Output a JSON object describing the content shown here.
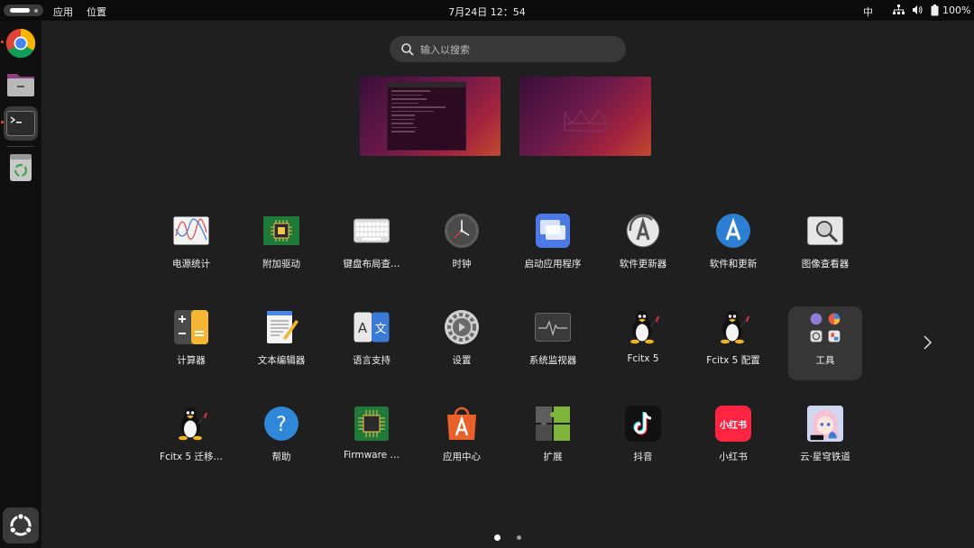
{
  "topbar": {
    "menu_apps": "应用",
    "menu_places": "位置",
    "clock": "7月24日  12：54",
    "ime": "中",
    "battery": "100%"
  },
  "dock": {
    "items": [
      {
        "name": "chrome",
        "icon": "chrome-icon"
      },
      {
        "name": "files",
        "icon": "folder-icon"
      },
      {
        "name": "terminal",
        "icon": "terminal-icon"
      },
      {
        "name": "trash",
        "icon": "trash-icon"
      },
      {
        "name": "show-apps",
        "icon": "ubuntu-icon"
      }
    ]
  },
  "search": {
    "placeholder": "输入以搜索"
  },
  "apps": [
    {
      "label": "电源统计",
      "icon": "power-statistics-icon"
    },
    {
      "label": "附加驱动",
      "icon": "chip-icon"
    },
    {
      "label": "键盘布局查…",
      "icon": "keyboard-icon"
    },
    {
      "label": "时钟",
      "icon": "clock-icon"
    },
    {
      "label": "启动应用程序",
      "icon": "startup-apps-icon"
    },
    {
      "label": "软件更新器",
      "icon": "software-updater-icon"
    },
    {
      "label": "软件和更新",
      "icon": "software-update-icon"
    },
    {
      "label": "图像查看器",
      "icon": "image-viewer-icon"
    },
    {
      "label": "计算器",
      "icon": "calculator-icon"
    },
    {
      "label": "文本编辑器",
      "icon": "text-editor-icon"
    },
    {
      "label": "语言支持",
      "icon": "language-icon"
    },
    {
      "label": "设置",
      "icon": "settings-icon"
    },
    {
      "label": "系统监视器",
      "icon": "system-monitor-icon"
    },
    {
      "label": "Fcitx 5",
      "icon": "tux-icon"
    },
    {
      "label": "Fcitx 5 配置",
      "icon": "tux-icon"
    },
    {
      "label": "工具",
      "icon": "folder-tools-icon"
    },
    {
      "label": "Fcitx 5 迁移…",
      "icon": "tux-icon"
    },
    {
      "label": "帮助",
      "icon": "help-icon"
    },
    {
      "label": "Firmware …",
      "icon": "firmware-icon"
    },
    {
      "label": "应用中心",
      "icon": "app-center-icon"
    },
    {
      "label": "扩展",
      "icon": "extensions-icon"
    },
    {
      "label": "抖音",
      "icon": "douyin-icon"
    },
    {
      "label": "小红书",
      "icon": "xiaohongshu-icon"
    },
    {
      "label": "云·星穹铁道",
      "icon": "game-icon"
    }
  ],
  "xhs_icon_text": "小红书",
  "pagination": {
    "pages": 2,
    "current": 1
  }
}
